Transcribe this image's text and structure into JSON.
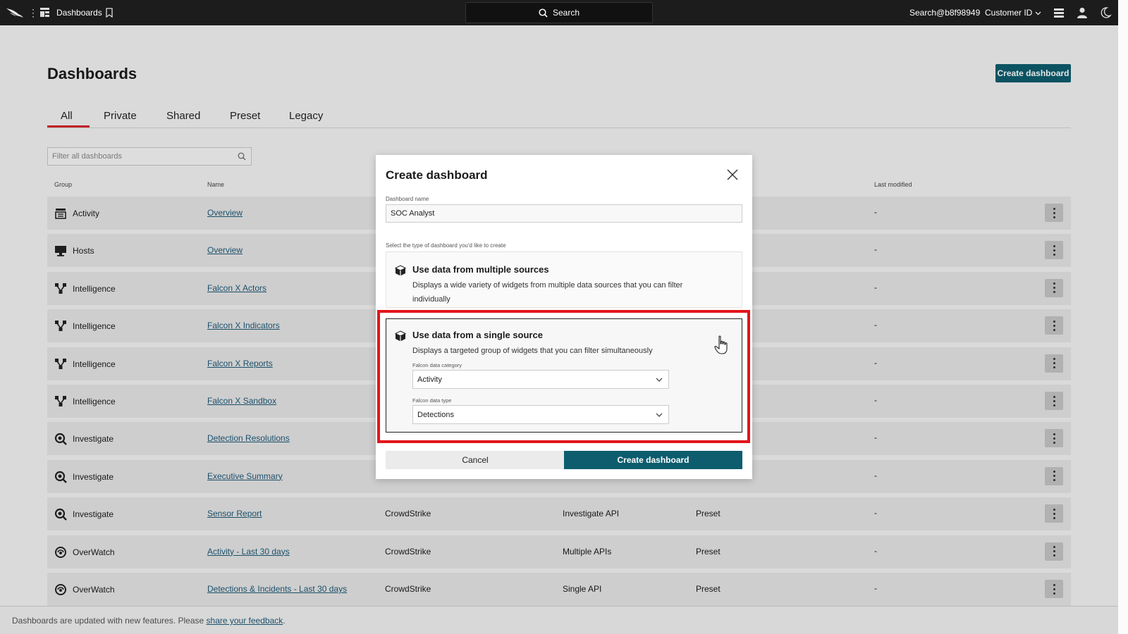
{
  "topbar": {
    "title": "Dashboards",
    "search_label": "Search",
    "user": "Search@b8f98949",
    "customer": "Customer ID"
  },
  "page": {
    "title": "Dashboards",
    "create_button": "Create dashboard",
    "filter_placeholder": "Filter all dashboards"
  },
  "tabs": [
    {
      "label": "All",
      "active": true
    },
    {
      "label": "Private"
    },
    {
      "label": "Shared"
    },
    {
      "label": "Preset"
    },
    {
      "label": "Legacy"
    }
  ],
  "columns": {
    "group": "Group",
    "name": "Name",
    "last_modified": "Last modified"
  },
  "rows": [
    {
      "group": "Activity",
      "name": "Overview",
      "author": "",
      "datasource": "",
      "type": "",
      "modified": "-",
      "icon": "activity-icon"
    },
    {
      "group": "Hosts",
      "name": "Overview",
      "author": "",
      "datasource": "",
      "type": "",
      "modified": "-",
      "icon": "monitor-icon"
    },
    {
      "group": "Intelligence",
      "name": "Falcon X Actors",
      "author": "",
      "datasource": "",
      "type": "",
      "modified": "-",
      "icon": "network-icon"
    },
    {
      "group": "Intelligence",
      "name": "Falcon X Indicators",
      "author": "",
      "datasource": "",
      "type": "",
      "modified": "-",
      "icon": "network-icon"
    },
    {
      "group": "Intelligence",
      "name": "Falcon X Reports",
      "author": "",
      "datasource": "",
      "type": "",
      "modified": "-",
      "icon": "network-icon"
    },
    {
      "group": "Intelligence",
      "name": "Falcon X Sandbox",
      "author": "",
      "datasource": "",
      "type": "",
      "modified": "-",
      "icon": "network-icon"
    },
    {
      "group": "Investigate",
      "name": "Detection Resolutions",
      "author": "",
      "datasource": "",
      "type": "",
      "modified": "-",
      "icon": "magnify-icon"
    },
    {
      "group": "Investigate",
      "name": "Executive Summary",
      "author": "",
      "datasource": "",
      "type": "",
      "modified": "-",
      "icon": "magnify-icon"
    },
    {
      "group": "Investigate",
      "name": "Sensor Report",
      "author": "CrowdStrike",
      "datasource": "Investigate API",
      "type": "Preset",
      "modified": "-",
      "icon": "magnify-icon"
    },
    {
      "group": "OverWatch",
      "name": "Activity - Last 30 days",
      "author": "CrowdStrike",
      "datasource": "Multiple APIs",
      "type": "Preset",
      "modified": "-",
      "icon": "overwatch-icon"
    },
    {
      "group": "OverWatch",
      "name": "Detections & Incidents - Last 30 days",
      "author": "CrowdStrike",
      "datasource": "Single API",
      "type": "Preset",
      "modified": "-",
      "icon": "overwatch-icon"
    }
  ],
  "footer": {
    "text": "Dashboards are updated with new features. Please ",
    "link": "share your feedback",
    "end": "."
  },
  "modal": {
    "title": "Create dashboard",
    "name_label": "Dashboard name",
    "name_value": "SOC Analyst",
    "type_label": "Select the type of dashboard you'd like to create",
    "option_multi": {
      "title": "Use data from multiple sources",
      "desc": "Displays a wide variety of widgets from multiple data sources that you can filter individually"
    },
    "option_single": {
      "title": "Use data from a single source",
      "desc": "Displays a targeted group of widgets that you can filter simultaneously",
      "category_label": "Falcon data category",
      "category_value": "Activity",
      "type_label": "Falcon data type",
      "type_value": "Detections"
    },
    "cancel": "Cancel",
    "create": "Create dashboard"
  },
  "colors": {
    "accent": "#0d5d6e",
    "tab_underline": "#d7262c",
    "highlight": "#e3151a",
    "topbar": "#1c1c1c"
  }
}
